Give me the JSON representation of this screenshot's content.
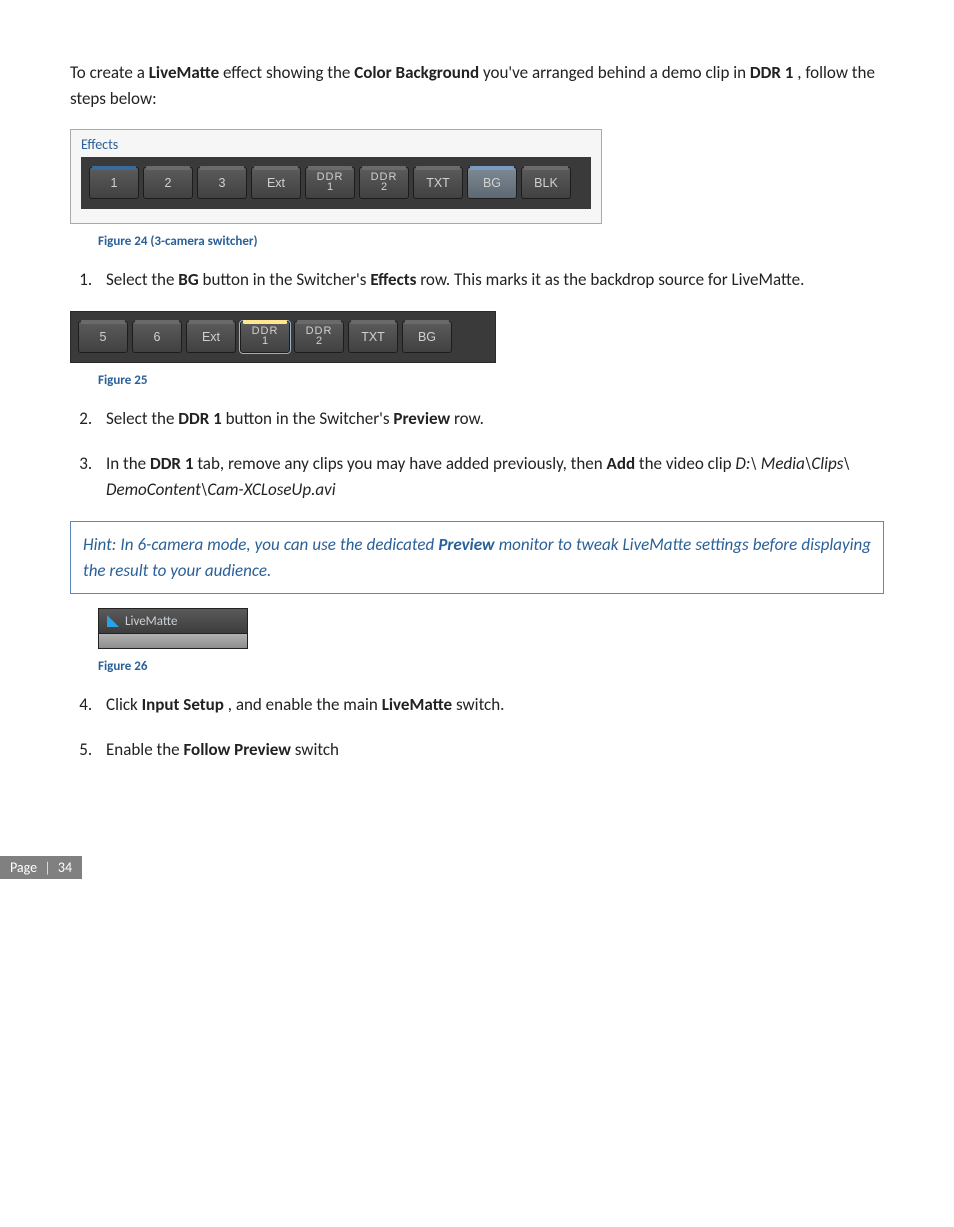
{
  "intro_para_1": "To create a ",
  "intro_bold_1": "LiveMatte",
  "intro_para_2": " effect showing the ",
  "intro_bold_2": "Color Background",
  "intro_para_3": " you've arranged behind a demo clip in ",
  "intro_bold_3": "DDR 1",
  "intro_para_4": ", follow the steps below:",
  "fig24": {
    "panel_label": "Effects",
    "buttons": [
      "1",
      "2",
      "3",
      "Ext",
      "DDR 1",
      "DDR 2",
      "TXT",
      "BG",
      "BLK"
    ],
    "caption": "Figure 24 (3-camera switcher)"
  },
  "step1_a": "Select the ",
  "step1_bold1": "BG",
  "step1_b": " button in the Switcher's ",
  "step1_bold2": "Effects",
  "step1_c": " row.  This marks it as the backdrop source for LiveMatte.",
  "fig25": {
    "buttons": [
      "5",
      "6",
      "Ext",
      "DDR 1",
      "DDR 2",
      "TXT",
      "BG"
    ],
    "caption": "Figure 25"
  },
  "step2_a": "Select the ",
  "step2_bold1": "DDR 1",
  "step2_b": " button in the Switcher's ",
  "step2_bold2": "Preview",
  "step2_c": " row.",
  "step3_a": "In the ",
  "step3_bold1": "DDR 1",
  "step3_b": " tab, remove any clips you may have added previously, then ",
  "step3_bold2": "Add",
  "step3_c": " the video clip ",
  "step3_italic": "D:\\ Media\\Clips\\ DemoContent\\Cam-XCLoseUp.avi",
  "hint_a": "Hint: In 6-camera mode, you can use the dedicated ",
  "hint_bold": "Preview",
  "hint_b": " monitor to tweak LiveMatte settings before displaying the result to your audience.",
  "fig26": {
    "tab_label": "LiveMatte",
    "caption": "Figure 26"
  },
  "step4_a": "Click ",
  "step4_bold1": "Input Setup",
  "step4_b": ", and enable the main ",
  "step4_bold2": "LiveMatte",
  "step4_c": " switch.",
  "step5_a": "Enable the ",
  "step5_bold1": "Follow Preview",
  "step5_b": " switch",
  "footer": {
    "label": "Page",
    "sep": "|",
    "num": "34"
  }
}
